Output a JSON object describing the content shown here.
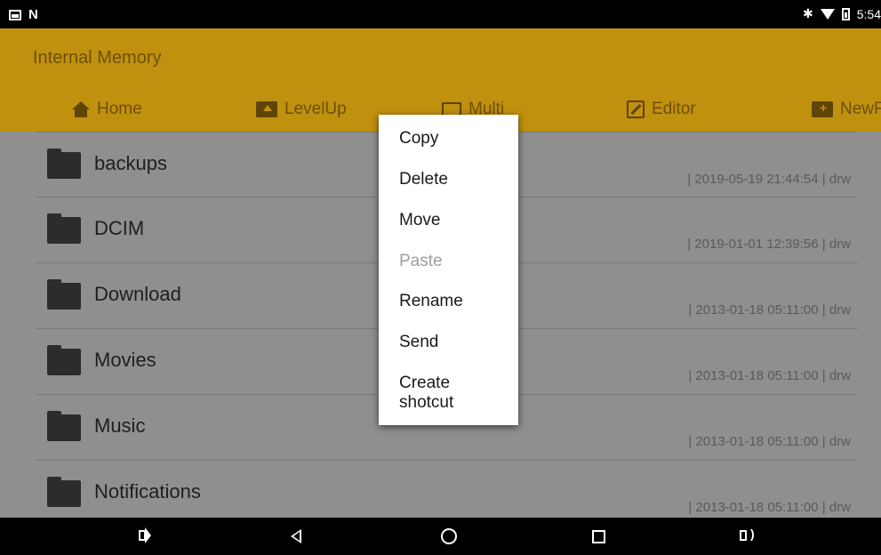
{
  "status_bar": {
    "left_icons": [
      "image-icon",
      "n-icon"
    ],
    "n_glyph": "N",
    "bt_glyph": "✱",
    "time": "5:54"
  },
  "header": {
    "title": "Internal Memory",
    "toolbar": [
      {
        "label": "Home",
        "icon": "home-icon"
      },
      {
        "label": "LevelUp",
        "icon": "folder-up-icon"
      },
      {
        "label": "Multi",
        "icon": "multi-icon"
      },
      {
        "label": "Editor",
        "icon": "edit-icon"
      },
      {
        "label": "NewF",
        "icon": "new-folder-icon"
      }
    ]
  },
  "files": [
    {
      "name": "backups",
      "meta": "| 2019-05-19 21:44:54 | drw"
    },
    {
      "name": "DCIM",
      "meta": "| 2019-01-01 12:39:56 | drw"
    },
    {
      "name": "Download",
      "meta": "| 2013-01-18 05:11:00 | drw"
    },
    {
      "name": "Movies",
      "meta": "| 2013-01-18 05:11:00 | drw"
    },
    {
      "name": "Music",
      "meta": "| 2013-01-18 05:11:00 | drw"
    },
    {
      "name": "Notifications",
      "meta": "| 2013-01-18 05:11:00 | drw"
    }
  ],
  "context_menu": {
    "items": [
      {
        "label": "Copy",
        "enabled": true
      },
      {
        "label": "Delete",
        "enabled": true
      },
      {
        "label": "Move",
        "enabled": true
      },
      {
        "label": "Paste",
        "enabled": false
      },
      {
        "label": "Rename",
        "enabled": true
      },
      {
        "label": "Send",
        "enabled": true
      },
      {
        "label": "Create",
        "label_line2": "shotcut",
        "enabled": true
      }
    ]
  },
  "nav_bar": [
    "volume-down-icon",
    "back-icon",
    "home-icon",
    "recents-icon",
    "volume-up-icon"
  ],
  "colors": {
    "header_bg": "#c0900f",
    "header_text": "#6e5008",
    "list_bg": "#8f8f8f",
    "menu_bg": "#ffffff"
  }
}
